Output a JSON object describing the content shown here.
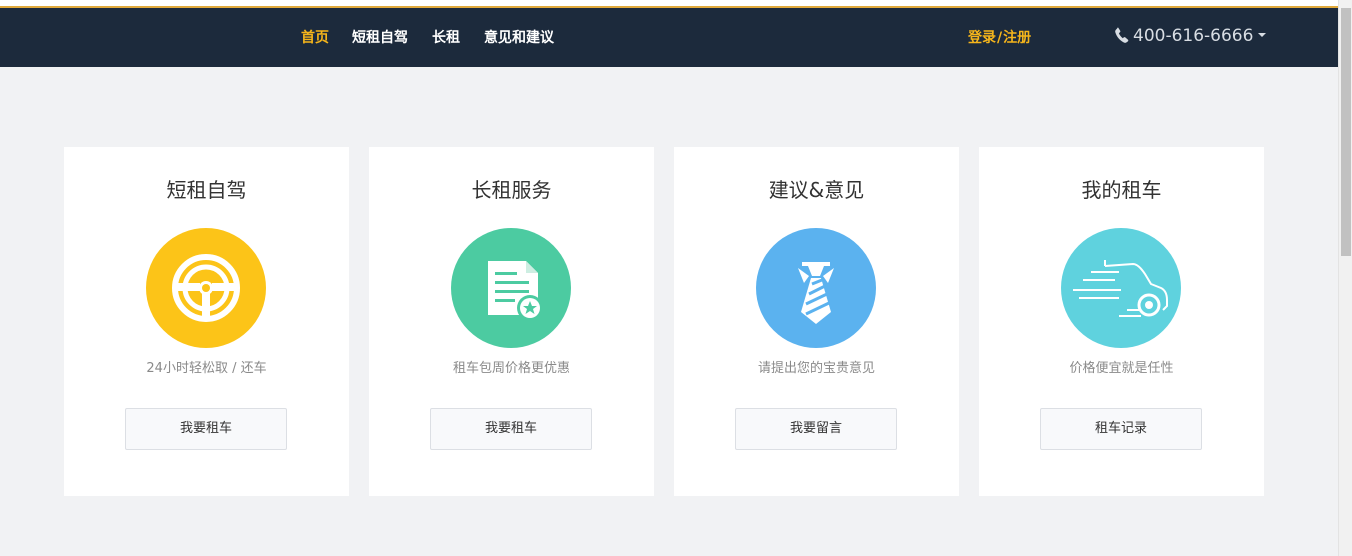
{
  "nav": {
    "items": [
      {
        "label": "首页",
        "active": true
      },
      {
        "label": "短租自驾",
        "active": false
      },
      {
        "label": "长租",
        "active": false
      },
      {
        "label": "意见和建议",
        "active": false
      }
    ],
    "login_label": "登录",
    "separator": "/",
    "register_label": "注册",
    "phone": "400-616-6666"
  },
  "colors": {
    "navbar_bg": "#1c2a3c",
    "accent": "#f5b51b",
    "page_bg": "#f1f2f4"
  },
  "cards": [
    {
      "title": "短租自驾",
      "icon": "steering-wheel-icon",
      "icon_color": "#fcc418",
      "desc": "24小时轻松取 / 还车",
      "button": "我要租车"
    },
    {
      "title": "长租服务",
      "icon": "document-star-icon",
      "icon_color": "#4ccba1",
      "desc": "租车包周价格更优惠",
      "button": "我要租车"
    },
    {
      "title": "建议&意见",
      "icon": "necktie-icon",
      "icon_color": "#5bb2ef",
      "desc": "请提出您的宝贵意见",
      "button": "我要留言"
    },
    {
      "title": "我的租车",
      "icon": "car-icon",
      "icon_color": "#5fd2de",
      "desc": "价格便宜就是任性",
      "button": "租车记录"
    }
  ]
}
